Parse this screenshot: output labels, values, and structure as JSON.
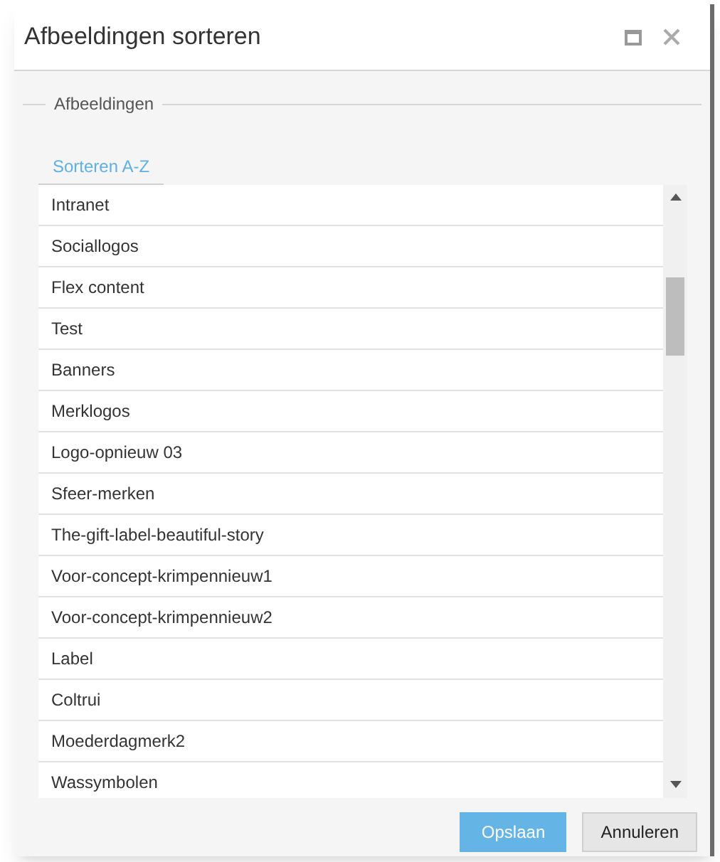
{
  "window": {
    "title": "Afbeeldingen sorteren"
  },
  "fieldset": {
    "legend": "Afbeeldingen"
  },
  "tabs": [
    {
      "label": "Sorteren A-Z",
      "selected": true
    }
  ],
  "list": {
    "items": [
      "Intranet",
      "Sociallogos",
      "Flex content",
      "Test",
      "Banners",
      "Merklogos",
      "Logo-opnieuw 03",
      "Sfeer-merken",
      "The-gift-label-beautiful-story",
      "Voor-concept-krimpennieuw1",
      "Voor-concept-krimpennieuw2",
      "Label",
      "Coltrui",
      "Moederdagmerk2",
      "Wassymbolen"
    ]
  },
  "buttons": [
    {
      "label": "Opslaan",
      "kind": "primary"
    },
    {
      "label": "Annuleren",
      "kind": "secondary"
    }
  ]
}
